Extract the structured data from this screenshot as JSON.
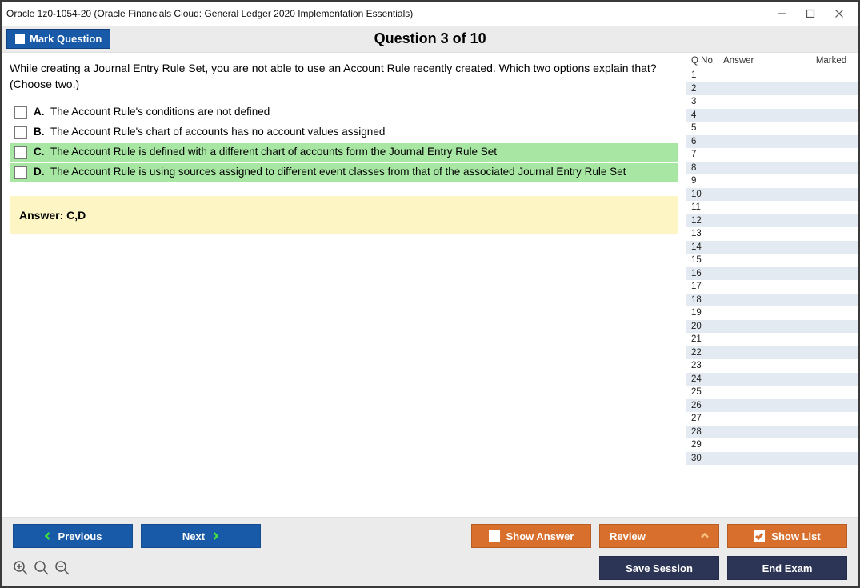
{
  "window": {
    "title": "Oracle 1z0-1054-20 (Oracle Financials Cloud: General Ledger 2020 Implementation Essentials)"
  },
  "header": {
    "mark_question_label": "Mark Question",
    "question_title": "Question 3 of 10"
  },
  "question": {
    "text": "While creating a Journal Entry Rule Set, you are not able to use an Account Rule recently created. Which two options explain that? (Choose two.)",
    "options": [
      {
        "key": "A.",
        "text": "The Account Rule's conditions are not defined",
        "correct": false
      },
      {
        "key": "B.",
        "text": "The Account Rule's chart of accounts has no account values assigned",
        "correct": false
      },
      {
        "key": "C.",
        "text": "The Account Rule is defined with a different chart of accounts form the Journal Entry Rule Set",
        "correct": true
      },
      {
        "key": "D.",
        "text": "The Account Rule is using sources assigned to different event classes from that of the associated Journal Entry Rule Set",
        "correct": true
      }
    ],
    "answer_label": "Answer: C,D"
  },
  "side": {
    "h_qno": "Q No.",
    "h_answer": "Answer",
    "h_marked": "Marked",
    "rows": [
      {
        "n": "1"
      },
      {
        "n": "2"
      },
      {
        "n": "3"
      },
      {
        "n": "4"
      },
      {
        "n": "5"
      },
      {
        "n": "6"
      },
      {
        "n": "7"
      },
      {
        "n": "8"
      },
      {
        "n": "9"
      },
      {
        "n": "10"
      },
      {
        "n": "11"
      },
      {
        "n": "12"
      },
      {
        "n": "13"
      },
      {
        "n": "14"
      },
      {
        "n": "15"
      },
      {
        "n": "16"
      },
      {
        "n": "17"
      },
      {
        "n": "18"
      },
      {
        "n": "19"
      },
      {
        "n": "20"
      },
      {
        "n": "21"
      },
      {
        "n": "22"
      },
      {
        "n": "23"
      },
      {
        "n": "24"
      },
      {
        "n": "25"
      },
      {
        "n": "26"
      },
      {
        "n": "27"
      },
      {
        "n": "28"
      },
      {
        "n": "29"
      },
      {
        "n": "30"
      }
    ]
  },
  "footer": {
    "previous": "Previous",
    "next": "Next",
    "show_answer": "Show Answer",
    "review": "Review",
    "show_list": "Show List",
    "save_session": "Save Session",
    "end_exam": "End Exam"
  }
}
